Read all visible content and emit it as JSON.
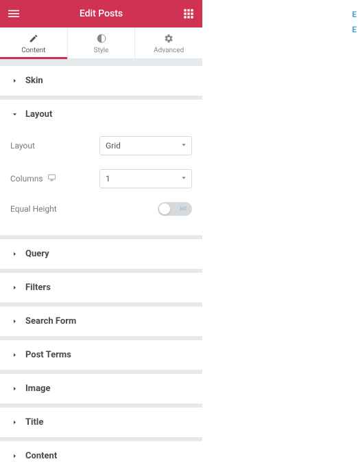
{
  "header": {
    "title": "Edit Posts"
  },
  "tabs": {
    "content": "Content",
    "style": "Style",
    "advanced": "Advanced"
  },
  "sections": {
    "skin": {
      "title": "Skin"
    },
    "layout": {
      "title": "Layout",
      "controls": {
        "layout_label": "Layout",
        "layout_value": "Grid",
        "columns_label": "Columns",
        "columns_value": "1",
        "equal_height_label": "Equal Height",
        "equal_height_off": "NO"
      }
    },
    "query": {
      "title": "Query"
    },
    "filters": {
      "title": "Filters"
    },
    "search_form": {
      "title": "Search Form"
    },
    "post_terms": {
      "title": "Post Terms"
    },
    "image": {
      "title": "Image"
    },
    "title_section": {
      "title": "Title"
    },
    "content_section": {
      "title": "Content"
    }
  },
  "colors": {
    "accent": "#d03254"
  }
}
